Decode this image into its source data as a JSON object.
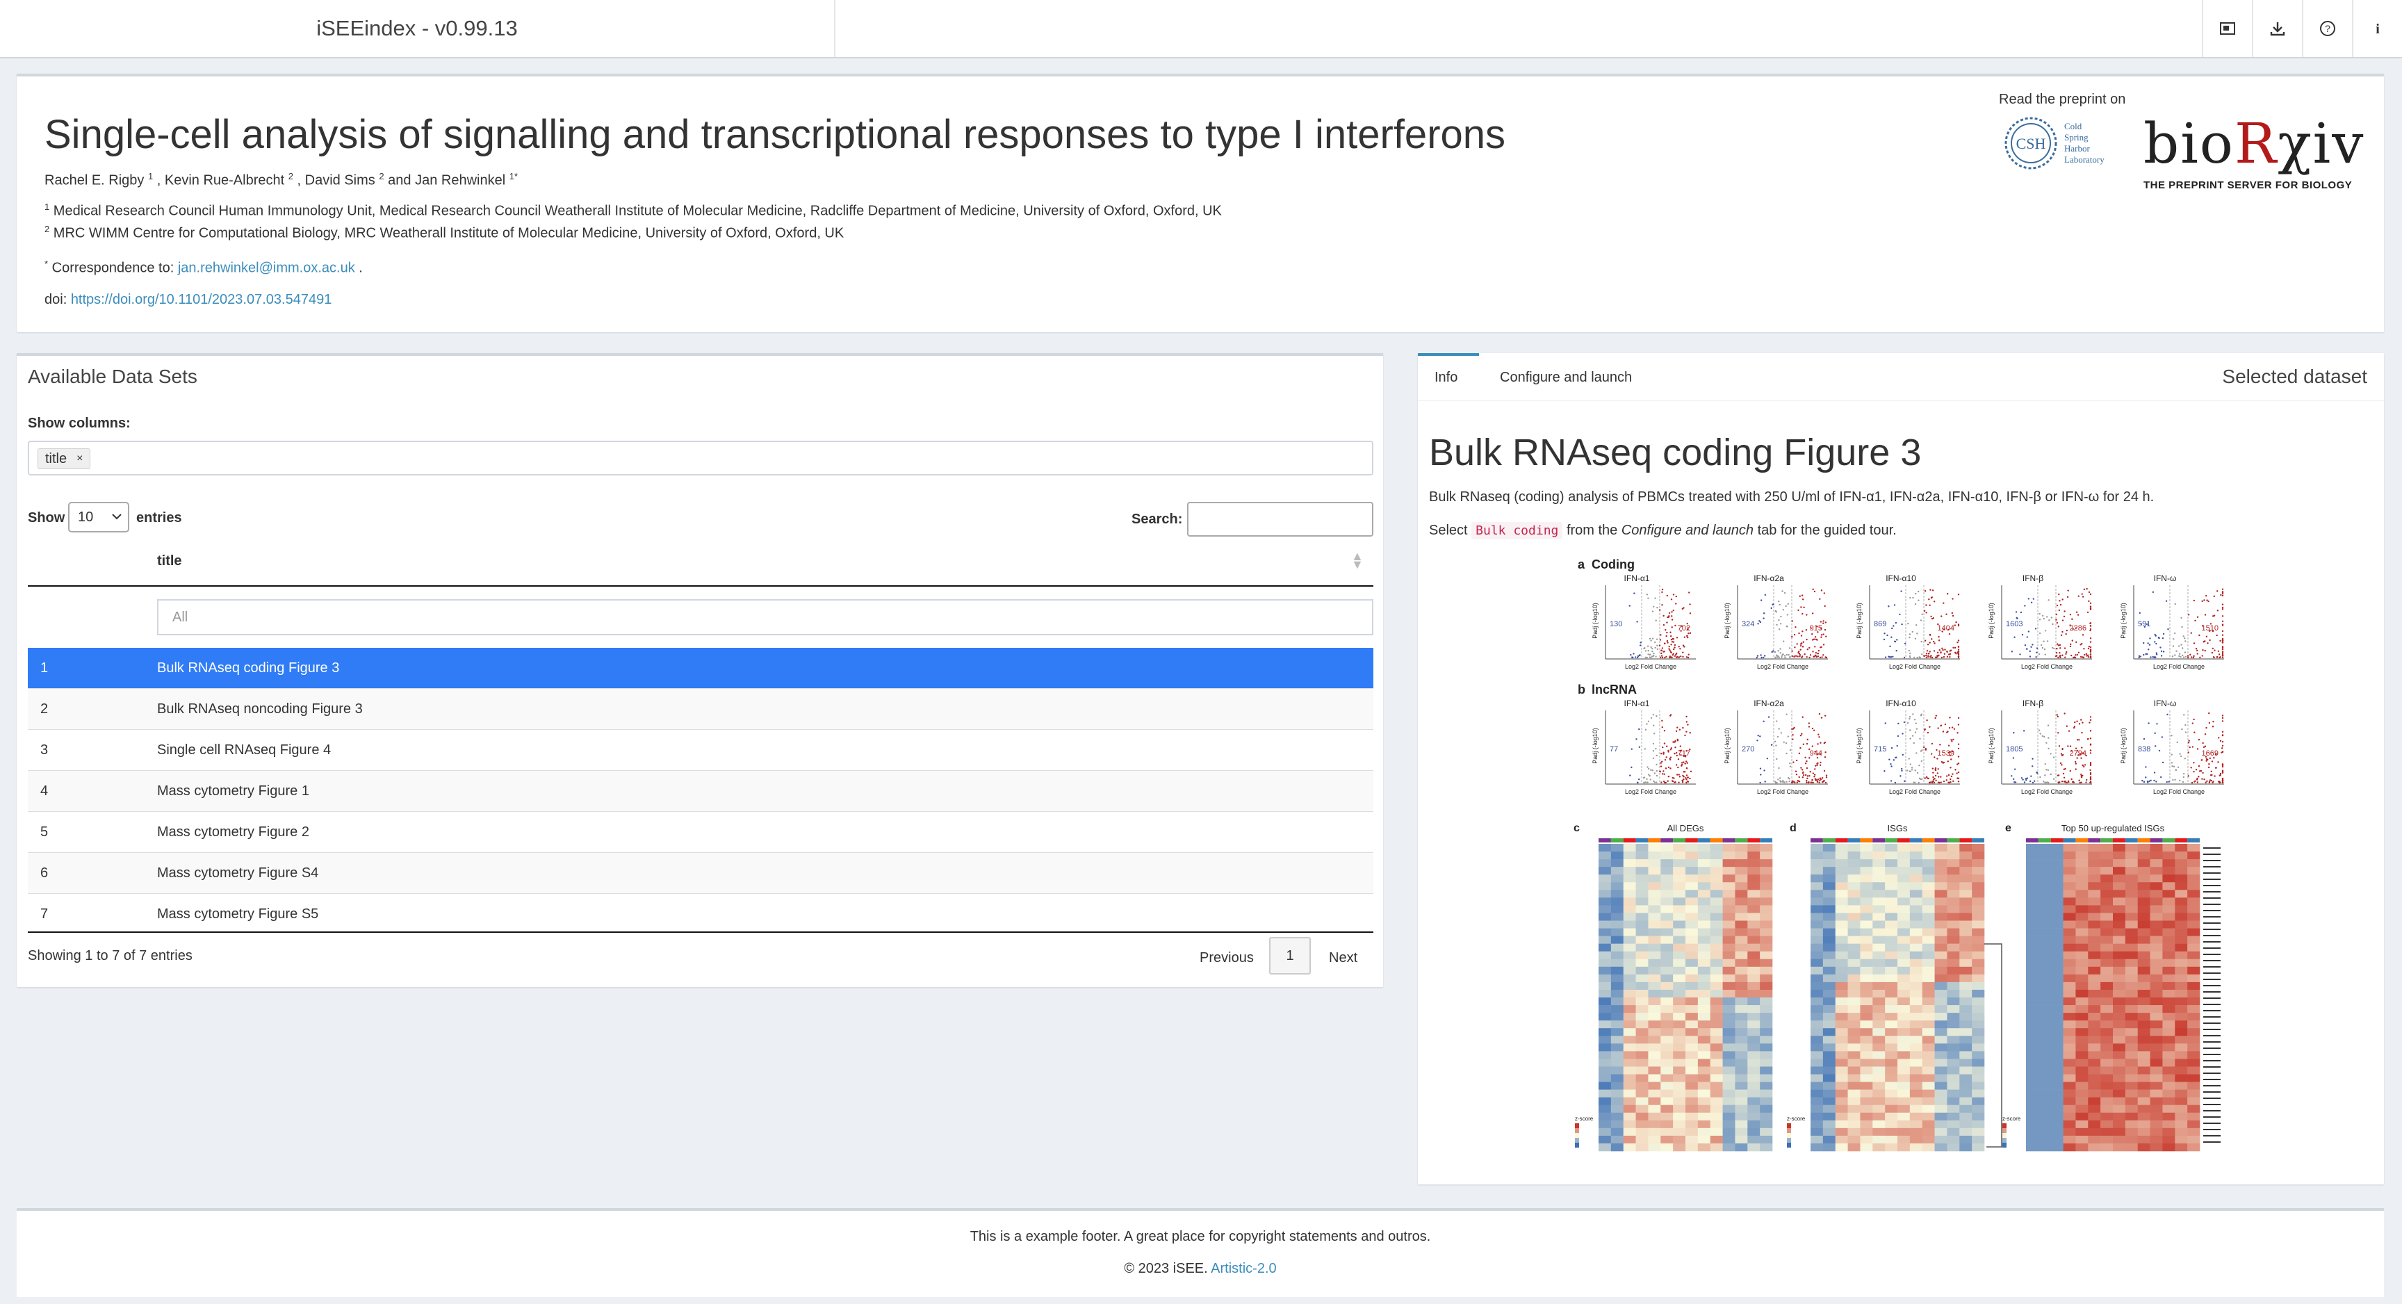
{
  "navbar": {
    "brand": "iSEEindex - v0.99.13",
    "icons": [
      "screenshot-icon",
      "download-icon",
      "help-icon",
      "info-icon"
    ]
  },
  "header": {
    "title": "Single-cell analysis of signalling and transcriptional responses to type I interferons",
    "authors": [
      {
        "name": "Rachel E. Rigby",
        "sup": "1",
        "sep": " , "
      },
      {
        "name": "Kevin Rue-Albrecht",
        "sup": "2",
        "sep": " , "
      },
      {
        "name": "David Sims",
        "sup": "2",
        "sep": " and "
      },
      {
        "name": "Jan Rehwinkel",
        "sup": "1*",
        "sep": ""
      }
    ],
    "affiliations": [
      {
        "sup": "1",
        "text": "Medical Research Council Human Immunology Unit, Medical Research Council Weatherall Institute of Molecular Medicine, Radcliffe Department of Medicine, University of Oxford, Oxford, UK"
      },
      {
        "sup": "2",
        "text": "MRC WIMM Centre for Computational Biology, MRC Weatherall Institute of Molecular Medicine, University of Oxford, Oxford, UK"
      }
    ],
    "correspondence_sup": "*",
    "correspondence_label": "Correspondence to:",
    "correspondence_email": "jan.rehwinkel@imm.ox.ac.uk",
    "correspondence_end": ".",
    "doi_label": "doi:",
    "doi_link": "https://doi.org/10.1101/2023.07.03.547491",
    "preprint_label": "Read the preprint on",
    "csh_initials": "CSH",
    "csh_text": [
      "Cold",
      "Spring",
      "Harbor",
      "Laboratory"
    ],
    "biorxiv_logo": "bioRχiv",
    "biorxiv_tagline": "THE PREPRINT SERVER FOR BIOLOGY"
  },
  "datasets": {
    "title": "Available Data Sets",
    "show_columns_label": "Show columns:",
    "column_chip": "title",
    "chip_remove": "×",
    "show_label": "Show",
    "entries_value": "10",
    "entries_label": "entries",
    "search_label": "Search:",
    "search_value": "",
    "column_header": "title",
    "filter_placeholder": "All",
    "rows": [
      {
        "num": "1",
        "title": "Bulk RNAseq coding Figure 3"
      },
      {
        "num": "2",
        "title": "Bulk RNAseq noncoding Figure 3"
      },
      {
        "num": "3",
        "title": "Single cell RNAseq Figure 4"
      },
      {
        "num": "4",
        "title": "Mass cytometry Figure 1"
      },
      {
        "num": "5",
        "title": "Mass cytometry Figure 2"
      },
      {
        "num": "6",
        "title": "Mass cytometry Figure S4"
      },
      {
        "num": "7",
        "title": "Mass cytometry Figure S5"
      }
    ],
    "selected_row": 1,
    "info": "Showing 1 to 7 of 7 entries",
    "prev": "Previous",
    "page": "1",
    "next": "Next"
  },
  "panel": {
    "tabs": [
      "Info",
      "Configure and launch"
    ],
    "active_tab": "Info",
    "right_title": "Selected dataset",
    "ds_title": "Bulk RNAseq coding Figure 3",
    "ds_desc": "Bulk RNaseq (coding) analysis of PBMCs treated with 250 U/ml of IFN-α1, IFN-α2a, IFN-α10, IFN-β or IFN-ω for 24 h.",
    "select_pre": "Select",
    "select_code": "Bulk coding",
    "select_mid": "from the",
    "select_em": "Configure and launch",
    "select_post": "tab for the guided tour."
  },
  "figure": {
    "row_a": {
      "letter": "a",
      "label": "Coding"
    },
    "row_b": {
      "letter": "b",
      "label": "lncRNA"
    },
    "volcano_titles": [
      "IFN-α1",
      "IFN-α2a",
      "IFN-α10",
      "IFN-β",
      "IFN-ω"
    ],
    "coding_down": [
      "130",
      "324",
      "869",
      "1603",
      "591"
    ],
    "coding_up": [
      "702",
      "915",
      "1404",
      "2286",
      "1510"
    ],
    "lnc_down": [
      "77",
      "270",
      "715",
      "1805",
      "838"
    ],
    "lnc_up": [
      "717",
      "944",
      "1539",
      "2794",
      "1669"
    ],
    "xlabel": "Log2 Fold Change",
    "ylabel": "Padj (-log10)",
    "heat_letters": [
      "c",
      "d",
      "e"
    ],
    "heat_titles": [
      "All DEGs",
      "ISGs",
      "Top 50 up-regulated ISGs"
    ],
    "zscore_label": "z-score",
    "colors": {
      "up": "#b22222",
      "down": "#3a4fa0",
      "heat_hi": "#c7362b",
      "heat_lo": "#3b6fb6"
    }
  },
  "footer": {
    "line1": "This is a example footer. A great place for copyright statements and outros.",
    "copyright": "© 2023 iSEE.",
    "license": "Artistic-2.0"
  }
}
